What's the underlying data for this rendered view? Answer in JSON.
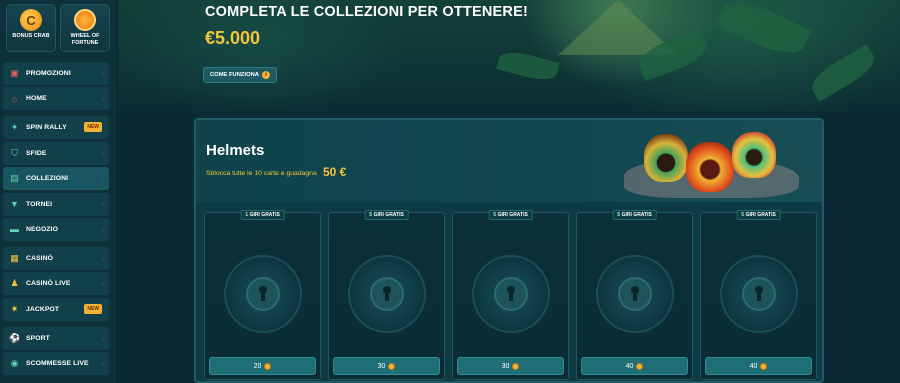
{
  "sidebar": {
    "tiles": [
      {
        "label": "BONUS CRAB",
        "icon": "crab-icon"
      },
      {
        "label": "WHEEL OF FORTUNE",
        "icon": "wheel-icon"
      }
    ],
    "items": [
      {
        "label": "PROMOZIONI",
        "icon": "gift-icon"
      },
      {
        "label": "HOME",
        "icon": "home-icon"
      },
      {
        "label": "SPIN RALLY",
        "icon": "rally-icon",
        "badge": "NEW"
      },
      {
        "label": "SFIDE",
        "icon": "shield-icon"
      },
      {
        "label": "COLLEZIONI",
        "icon": "cards-icon"
      },
      {
        "label": "TORNEI",
        "icon": "trophy-icon"
      },
      {
        "label": "NEGOZIO",
        "icon": "shop-icon"
      },
      {
        "label": "CASINÒ",
        "icon": "slot-icon"
      },
      {
        "label": "CASINÒ LIVE",
        "icon": "dealer-icon"
      },
      {
        "label": "JACKPOT",
        "icon": "jackpot-icon",
        "badge": "NEW"
      },
      {
        "label": "SPORT",
        "icon": "football-icon"
      },
      {
        "label": "SCOMMESSE LIVE",
        "icon": "live-bet-icon"
      }
    ]
  },
  "hero": {
    "title": "COMPLETA LE COLLEZIONI PER OTTENERE!",
    "amount": "€5.000",
    "how_button": "COME FUNZIONA"
  },
  "collection": {
    "title": "Helmets",
    "subtitle": "Sblocca tutte le 10 carte e guadagna",
    "reward": "50 €",
    "cards": [
      {
        "spins": "1",
        "spins_label": "GIRI GRATIS",
        "price": "20"
      },
      {
        "spins": "5",
        "spins_label": "GIRI GRATIS",
        "price": "30"
      },
      {
        "spins": "5",
        "spins_label": "GIRI GRATIS",
        "price": "30"
      },
      {
        "spins": "5",
        "spins_label": "GIRI GRATIS",
        "price": "40"
      },
      {
        "spins": "5",
        "spins_label": "GIRI GRATIS",
        "price": "40"
      }
    ]
  },
  "colors": {
    "accent_gold": "#f4c53a",
    "teal_button": "#1f6e75",
    "badge_new": "#f2b233"
  }
}
